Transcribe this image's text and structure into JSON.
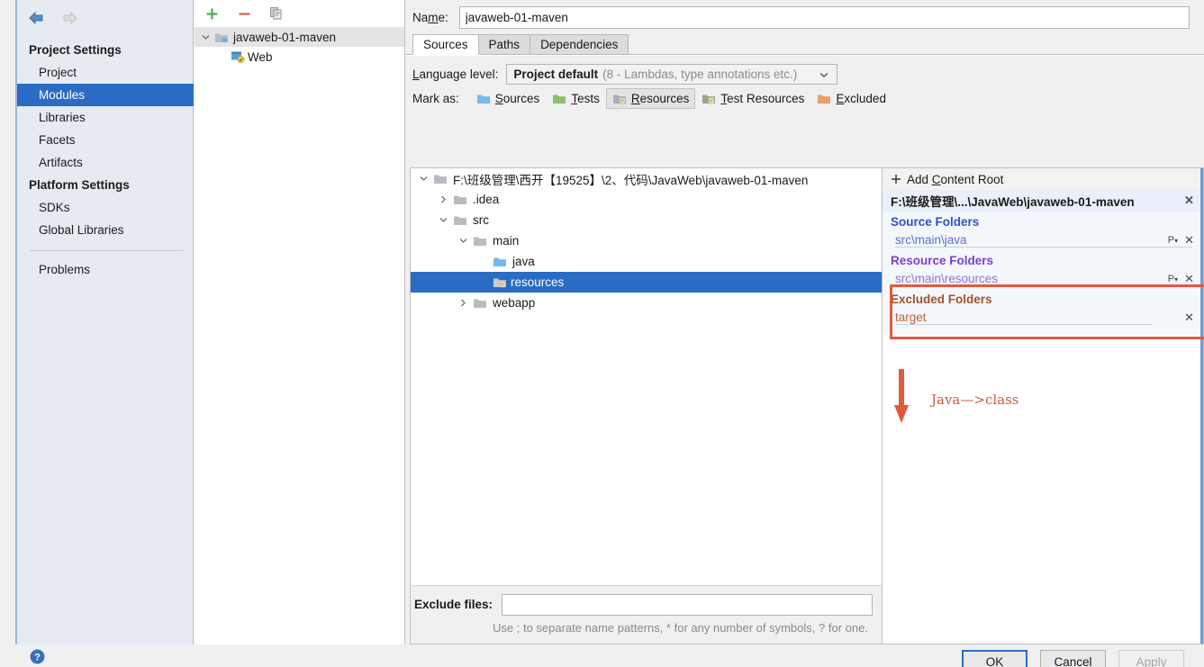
{
  "sidebar": {
    "back_icon": "arrow-left-icon",
    "forward_icon": "arrow-right-icon",
    "groups": [
      {
        "title": "Project Settings",
        "items": [
          {
            "label": "Project",
            "selected": false
          },
          {
            "label": "Modules",
            "selected": true
          },
          {
            "label": "Libraries",
            "selected": false
          },
          {
            "label": "Facets",
            "selected": false
          },
          {
            "label": "Artifacts",
            "selected": false
          }
        ]
      },
      {
        "title": "Platform Settings",
        "items": [
          {
            "label": "SDKs",
            "selected": false
          },
          {
            "label": "Global Libraries",
            "selected": false
          }
        ]
      }
    ],
    "problems_label": "Problems"
  },
  "modules": {
    "toolbar": {
      "add_label": "+",
      "remove_label": "−",
      "copy_label": "copy-icon"
    },
    "tree": [
      {
        "label": "javaweb-01-maven",
        "level": 0,
        "expanded": true,
        "selected": true,
        "icon": "module-folder-icon"
      },
      {
        "label": "Web",
        "level": 1,
        "expanded": null,
        "selected": false,
        "icon": "web-facet-icon"
      }
    ]
  },
  "main": {
    "name_label": "Name:",
    "name_value": "javaweb-01-maven",
    "tabs": [
      {
        "label": "Sources",
        "active": true
      },
      {
        "label": "Paths",
        "active": false
      },
      {
        "label": "Dependencies",
        "active": false
      }
    ],
    "language_level": {
      "label": "Language level:",
      "value": "Project default",
      "hint": "(8 - Lambdas, type annotations etc.)",
      "chevron_icon": "chevron-down-icon"
    },
    "mark_as": {
      "label": "Mark as:",
      "options": [
        {
          "label": "Sources",
          "mnemonic": "S",
          "rest": "ources",
          "color": "#79b8e8",
          "kind": "plain",
          "pressed": false
        },
        {
          "label": "Tests",
          "mnemonic": "T",
          "rest": "ests",
          "color": "#8cbf6e",
          "kind": "plain",
          "pressed": false
        },
        {
          "label": "Resources",
          "mnemonic": "R",
          "rest": "esources",
          "color": "#a8b0b8",
          "kind": "lined",
          "pressed": true
        },
        {
          "label": "Test Resources",
          "mnemonic": "T",
          "rest": "est Resources",
          "color": "#9aa48c",
          "kind": "lined",
          "pressed": false
        },
        {
          "label": "Excluded",
          "mnemonic": "E",
          "rest": "xcluded",
          "color": "#e8a06a",
          "kind": "plain",
          "pressed": false
        }
      ]
    },
    "source_tree": [
      {
        "label": "F:\\班级管理\\西开【19525】\\2、代码\\JavaWeb\\javaweb-01-maven",
        "level": 0,
        "twisty": "expanded",
        "icon": "folder-gray-icon",
        "selected": false
      },
      {
        "label": ".idea",
        "level": 1,
        "twisty": "collapsed",
        "icon": "folder-gray-icon",
        "selected": false
      },
      {
        "label": "src",
        "level": 1,
        "twisty": "expanded",
        "icon": "folder-gray-icon",
        "selected": false
      },
      {
        "label": "main",
        "level": 2,
        "twisty": "expanded",
        "icon": "folder-gray-icon",
        "selected": false
      },
      {
        "label": "java",
        "level": 3,
        "twisty": "none",
        "icon": "folder-blue-icon",
        "selected": false
      },
      {
        "label": "resources",
        "level": 3,
        "twisty": "none",
        "icon": "folder-resources-icon",
        "selected": true
      },
      {
        "label": "webapp",
        "level": 2,
        "twisty": "collapsed",
        "icon": "folder-gray-icon",
        "selected": false
      }
    ],
    "exclude_files": {
      "label": "Exclude files:",
      "value": "",
      "hint": "Use ; to separate name patterns, * for any number of symbols, ? for one."
    }
  },
  "roots": {
    "add_content_root": {
      "icon": "plus-icon",
      "label_pre": "Add ",
      "mnemonic": "C",
      "label_post": "ontent Root"
    },
    "content_root": {
      "path": "F:\\班级管理\\...\\JavaWeb\\javaweb-01-maven",
      "close_icon": "close-icon"
    },
    "sections": [
      {
        "title": "Source Folders",
        "kind": "src",
        "color": "#2c50c8",
        "folders": [
          {
            "path": "src\\main\\java",
            "has_props": true,
            "props_icon": "package-prefix-icon",
            "close_icon": "close-icon"
          }
        ]
      },
      {
        "title": "Resource Folders",
        "kind": "res",
        "color": "#7b3fd4",
        "folders": [
          {
            "path": "src\\main\\resources",
            "has_props": true,
            "props_icon": "package-prefix-icon",
            "close_icon": "close-icon"
          }
        ]
      },
      {
        "title": "Excluded Folders",
        "kind": "exc",
        "color": "#a0522d",
        "folders": [
          {
            "path": "target",
            "has_props": false,
            "props_icon": "",
            "close_icon": "close-icon"
          }
        ]
      }
    ]
  },
  "annotation": {
    "arrow_icon": "arrow-down-icon",
    "text": "Java—>class",
    "color": "#cf5a43",
    "highlight_color": "#e05a3c"
  },
  "bottom": {
    "help_icon": "help-icon",
    "buttons": [
      {
        "label": "OK",
        "state": "default"
      },
      {
        "label": "Cancel",
        "state": "normal"
      },
      {
        "label": "Apply",
        "state": "disabled"
      }
    ]
  }
}
